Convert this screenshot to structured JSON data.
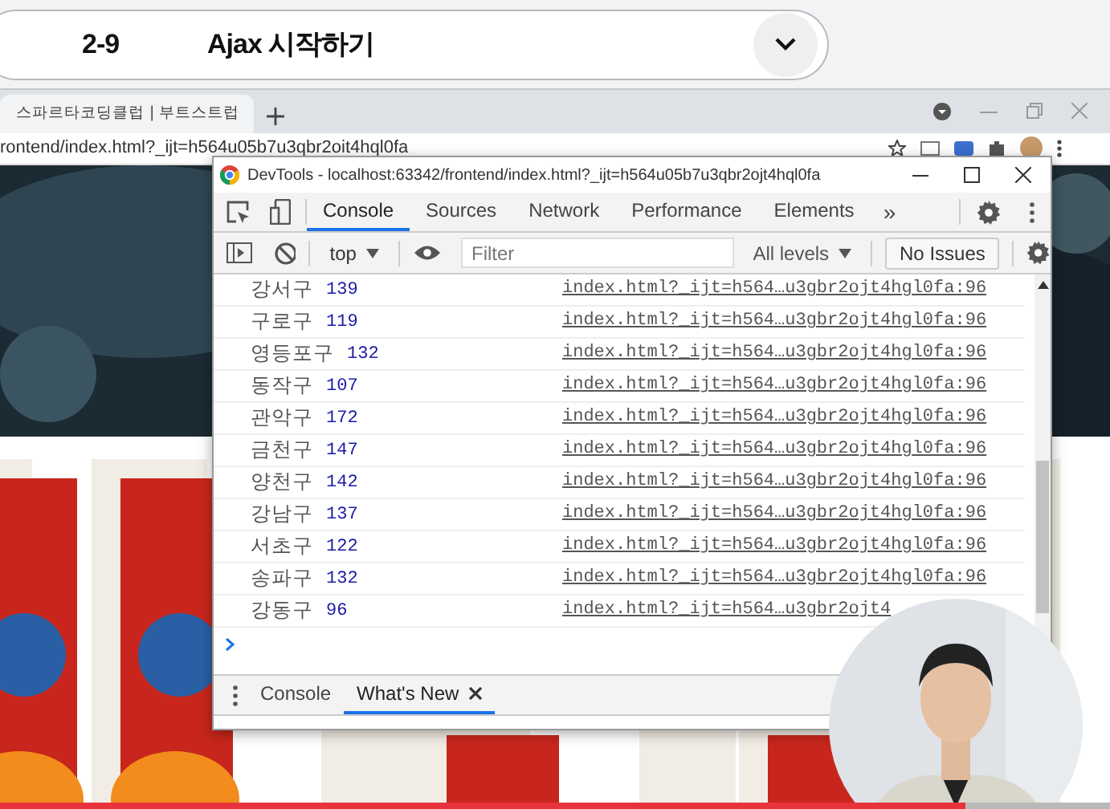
{
  "lesson_header": {
    "number": "2-9",
    "title": "Ajax 시작하기"
  },
  "browser": {
    "tab_title": "스파르타코딩클럽 | 부트스트럽",
    "address": "rontend/index.html?_ijt=h564u05b7u3qbr2oit4hql0fa"
  },
  "devtools": {
    "title": "DevTools - localhost:63342/frontend/index.html?_ijt=h564u05b7u3qbr2ojt4hql0fa",
    "tabs": [
      {
        "label": "Console",
        "selected": true
      },
      {
        "label": "Sources",
        "selected": false
      },
      {
        "label": "Network",
        "selected": false
      },
      {
        "label": "Performance",
        "selected": false
      },
      {
        "label": "Elements",
        "selected": false
      }
    ],
    "more_tabs": "»",
    "context": "top",
    "filter": {
      "placeholder": "Filter"
    },
    "levels": "All levels",
    "issues": "No Issues",
    "messages": [
      {
        "name": "강서구",
        "count": "139",
        "source": "index.html?_ijt=h564…u3gbr2ojt4hgl0fa:96"
      },
      {
        "name": "구로구",
        "count": "119",
        "source": "index.html?_ijt=h564…u3gbr2ojt4hgl0fa:96"
      },
      {
        "name": "영등포구",
        "count": "132",
        "source": "index.html?_ijt=h564…u3gbr2ojt4hgl0fa:96"
      },
      {
        "name": "동작구",
        "count": "107",
        "source": "index.html?_ijt=h564…u3gbr2ojt4hgl0fa:96"
      },
      {
        "name": "관악구",
        "count": "172",
        "source": "index.html?_ijt=h564…u3gbr2ojt4hgl0fa:96"
      },
      {
        "name": "금천구",
        "count": "147",
        "source": "index.html?_ijt=h564…u3gbr2ojt4hgl0fa:96"
      },
      {
        "name": "양천구",
        "count": "142",
        "source": "index.html?_ijt=h564…u3gbr2ojt4hgl0fa:96"
      },
      {
        "name": "강남구",
        "count": "137",
        "source": "index.html?_ijt=h564…u3gbr2ojt4hgl0fa:96"
      },
      {
        "name": "서초구",
        "count": "122",
        "source": "index.html?_ijt=h564…u3gbr2ojt4hgl0fa:96"
      },
      {
        "name": "송파구",
        "count": "132",
        "source": "index.html?_ijt=h564…u3gbr2ojt4hgl0fa:96"
      },
      {
        "name": "강동구",
        "count": "96",
        "source": "index.html?_ijt=h564…u3gbr2ojt4"
      }
    ],
    "drawer_tabs": [
      {
        "label": "Console",
        "selected": false,
        "closable": false
      },
      {
        "label": "What's New",
        "selected": true,
        "closable": true
      }
    ]
  },
  "video": {
    "level": 0.87
  }
}
